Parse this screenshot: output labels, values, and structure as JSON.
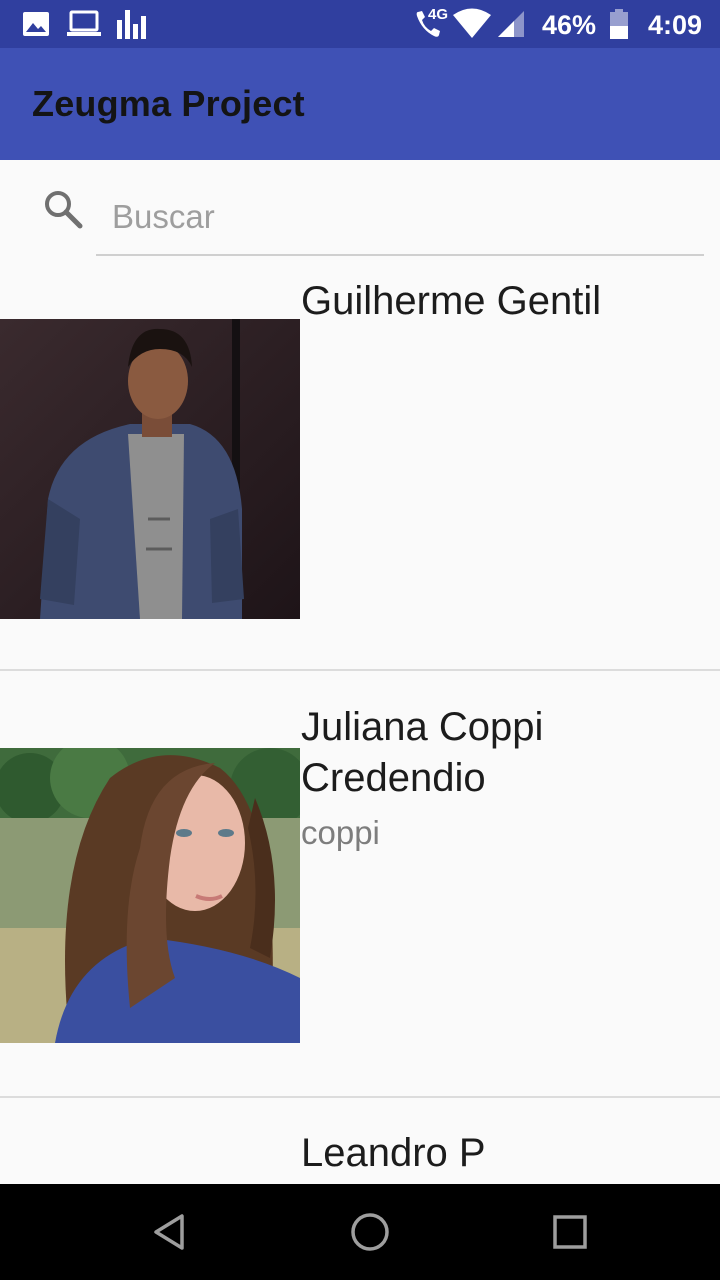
{
  "status_bar": {
    "icons_left": [
      "image-icon",
      "laptop-icon",
      "bar-chart-icon"
    ],
    "network": "4G",
    "battery": "46%",
    "time": "4:09"
  },
  "app_bar": {
    "title": "Zeugma Project"
  },
  "search": {
    "placeholder": "Buscar",
    "value": ""
  },
  "list": {
    "items": [
      {
        "name": "Guilherme Gentil",
        "subtitle": ""
      },
      {
        "name": "Juliana Coppi Credendio",
        "subtitle": "coppi"
      },
      {
        "name": "Leandro P",
        "subtitle": ""
      }
    ]
  },
  "nav_bar": {
    "buttons": [
      "back-icon",
      "home-icon",
      "recents-icon"
    ]
  },
  "colors": {
    "status_bar": "#303f9f",
    "app_bar": "#3f51b5",
    "background": "#fafafa"
  }
}
